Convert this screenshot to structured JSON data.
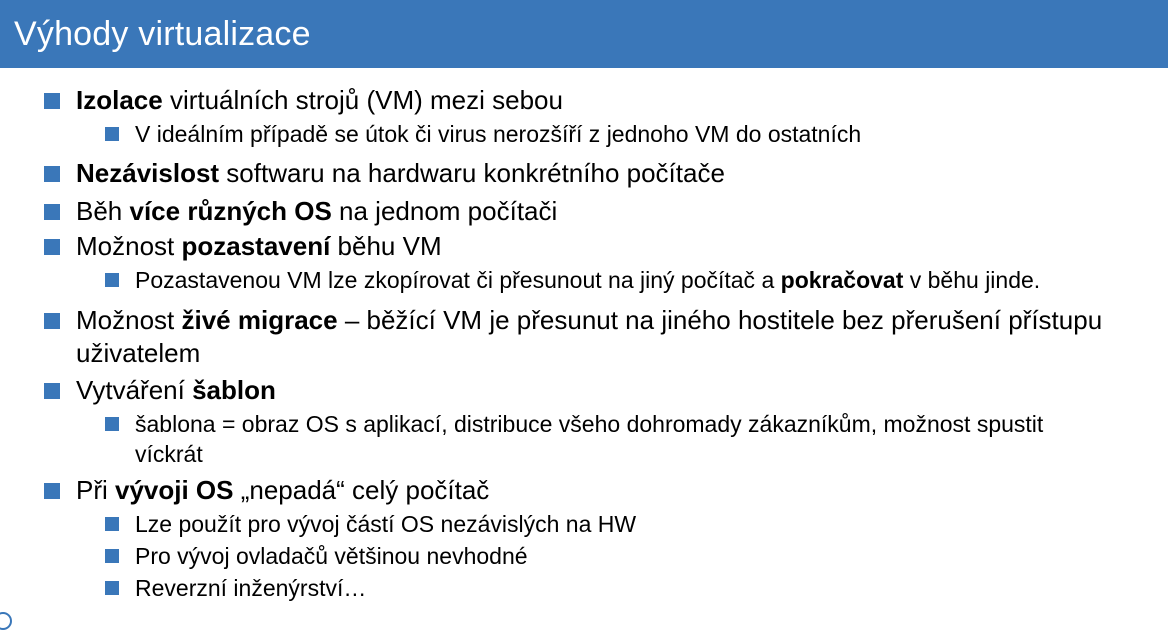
{
  "slide": {
    "title": "Výhody virtualizace"
  },
  "bullets": [
    {
      "level": 1,
      "segments": [
        {
          "text": "Izolace",
          "bold": true
        },
        {
          "text": " virtuálních strojů (VM) mezi sebou",
          "bold": false
        }
      ]
    },
    {
      "level": 2,
      "segments": [
        {
          "text": "V ideálním případě se útok či virus nerozšíří z jednoho VM do ostatních",
          "bold": false
        }
      ]
    },
    {
      "level": 1,
      "segments": [
        {
          "text": "Nezávislost",
          "bold": true
        },
        {
          "text": " softwaru na hardwaru konkrétního počítače",
          "bold": false
        }
      ]
    },
    {
      "level": 1,
      "segments": [
        {
          "text": "Běh ",
          "bold": false
        },
        {
          "text": "více různých OS",
          "bold": true
        },
        {
          "text": " na jednom počítači",
          "bold": false
        }
      ]
    },
    {
      "level": 1,
      "segments": [
        {
          "text": "Možnost ",
          "bold": false
        },
        {
          "text": "pozastavení",
          "bold": true
        },
        {
          "text": " běhu VM",
          "bold": false
        }
      ]
    },
    {
      "level": 2,
      "segments": [
        {
          "text": "Pozastavenou VM lze zkopírovat či přesunout na jiný počítač a ",
          "bold": false
        },
        {
          "text": "pokračovat",
          "bold": true
        },
        {
          "text": " v běhu jinde.",
          "bold": false
        }
      ]
    },
    {
      "level": 1,
      "segments": [
        {
          "text": "Možnost ",
          "bold": false
        },
        {
          "text": "živé migrace",
          "bold": true
        },
        {
          "text": " – běžící VM je přesunut na jiného hostitele bez přerušení přístupu uživatelem",
          "bold": false
        }
      ]
    },
    {
      "level": 1,
      "segments": [
        {
          "text": "Vytváření ",
          "bold": false
        },
        {
          "text": "šablon",
          "bold": true
        }
      ]
    },
    {
      "level": 2,
      "segments": [
        {
          "text": "šablona = obraz OS s aplikací, distribuce všeho dohromady zákazníkům, možnost spustit víckrát",
          "bold": false
        }
      ]
    },
    {
      "level": 1,
      "segments": [
        {
          "text": "Při ",
          "bold": false
        },
        {
          "text": "vývoji OS",
          "bold": true
        },
        {
          "text": " „nepadá“ celý počítač",
          "bold": false
        }
      ]
    },
    {
      "level": 2,
      "segments": [
        {
          "text": "Lze použít pro vývoj částí OS nezávislých na HW",
          "bold": false
        }
      ]
    },
    {
      "level": 2,
      "segments": [
        {
          "text": "Pro vývoj ovladačů většinou nevhodné",
          "bold": false
        }
      ]
    },
    {
      "level": 2,
      "segments": [
        {
          "text": "Reverzní inženýrství…",
          "bold": false
        }
      ]
    }
  ],
  "colors": {
    "accent": "#3a77b9",
    "title_text": "#ffffff",
    "body_text": "#000000"
  }
}
